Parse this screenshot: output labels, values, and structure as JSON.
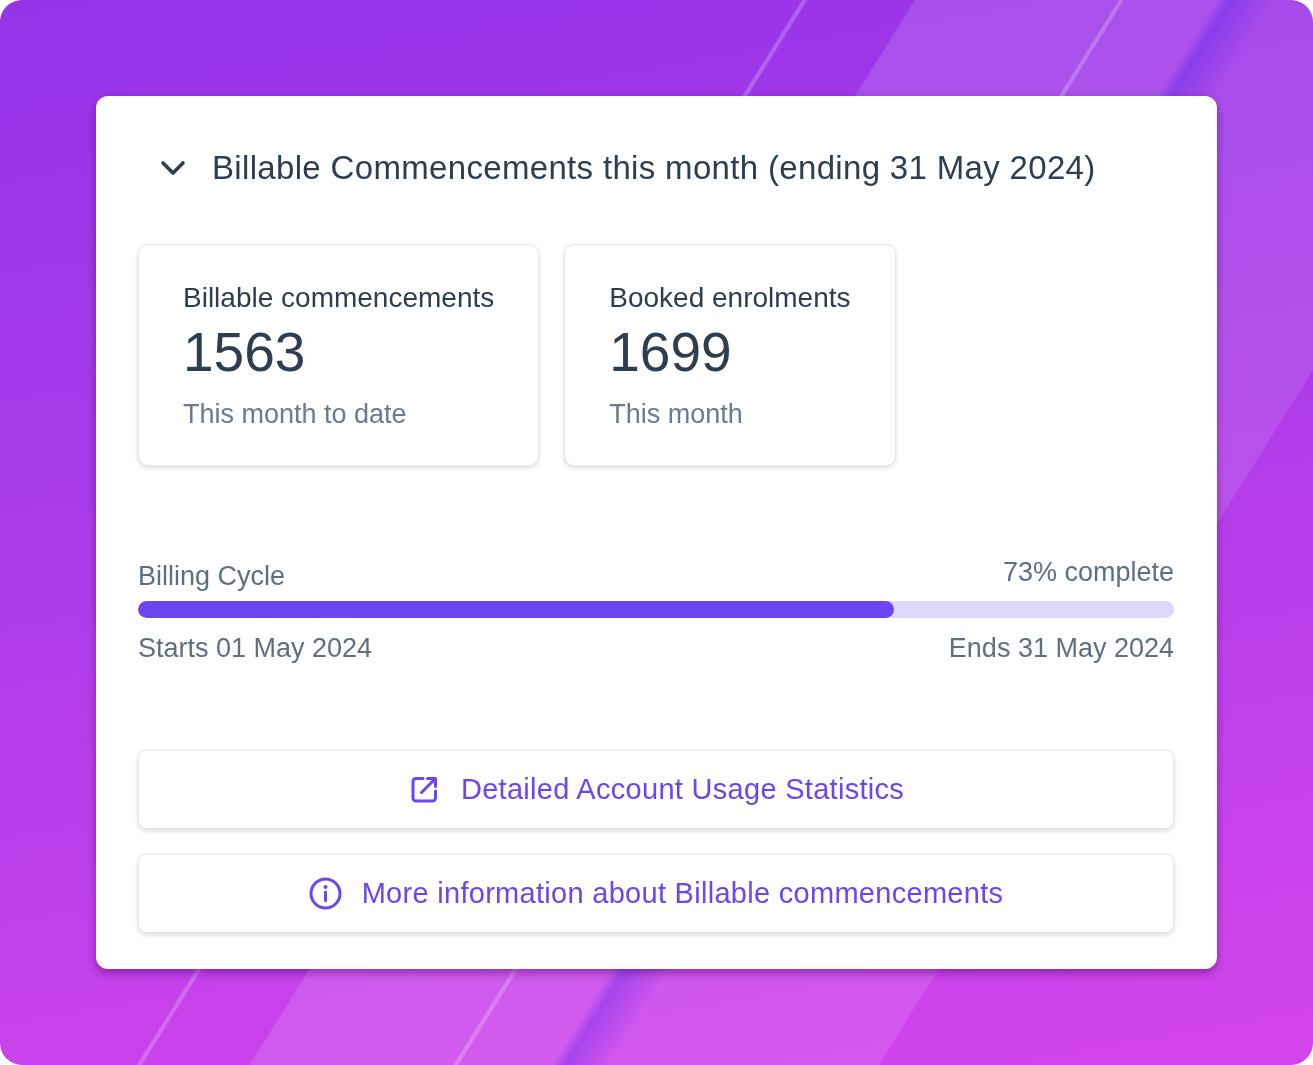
{
  "header": {
    "title": "Billable Commencements this month (ending 31 May 2024)",
    "expanded": true
  },
  "stats": [
    {
      "label": "Billable commencements",
      "value": "1563",
      "caption": "This month to date"
    },
    {
      "label": "Booked enrolments",
      "value": "1699",
      "caption": "This month"
    }
  ],
  "billing_cycle": {
    "label": "Billing Cycle",
    "reading": "73% complete",
    "level": 0.73,
    "start": "Starts 01 May 2024",
    "end": "Ends 31 May 2024"
  },
  "links": [
    {
      "kind": "external",
      "label": "Detailed Account Usage Statistics"
    },
    {
      "kind": "info",
      "label": "More information about Billable commencements"
    }
  ]
}
